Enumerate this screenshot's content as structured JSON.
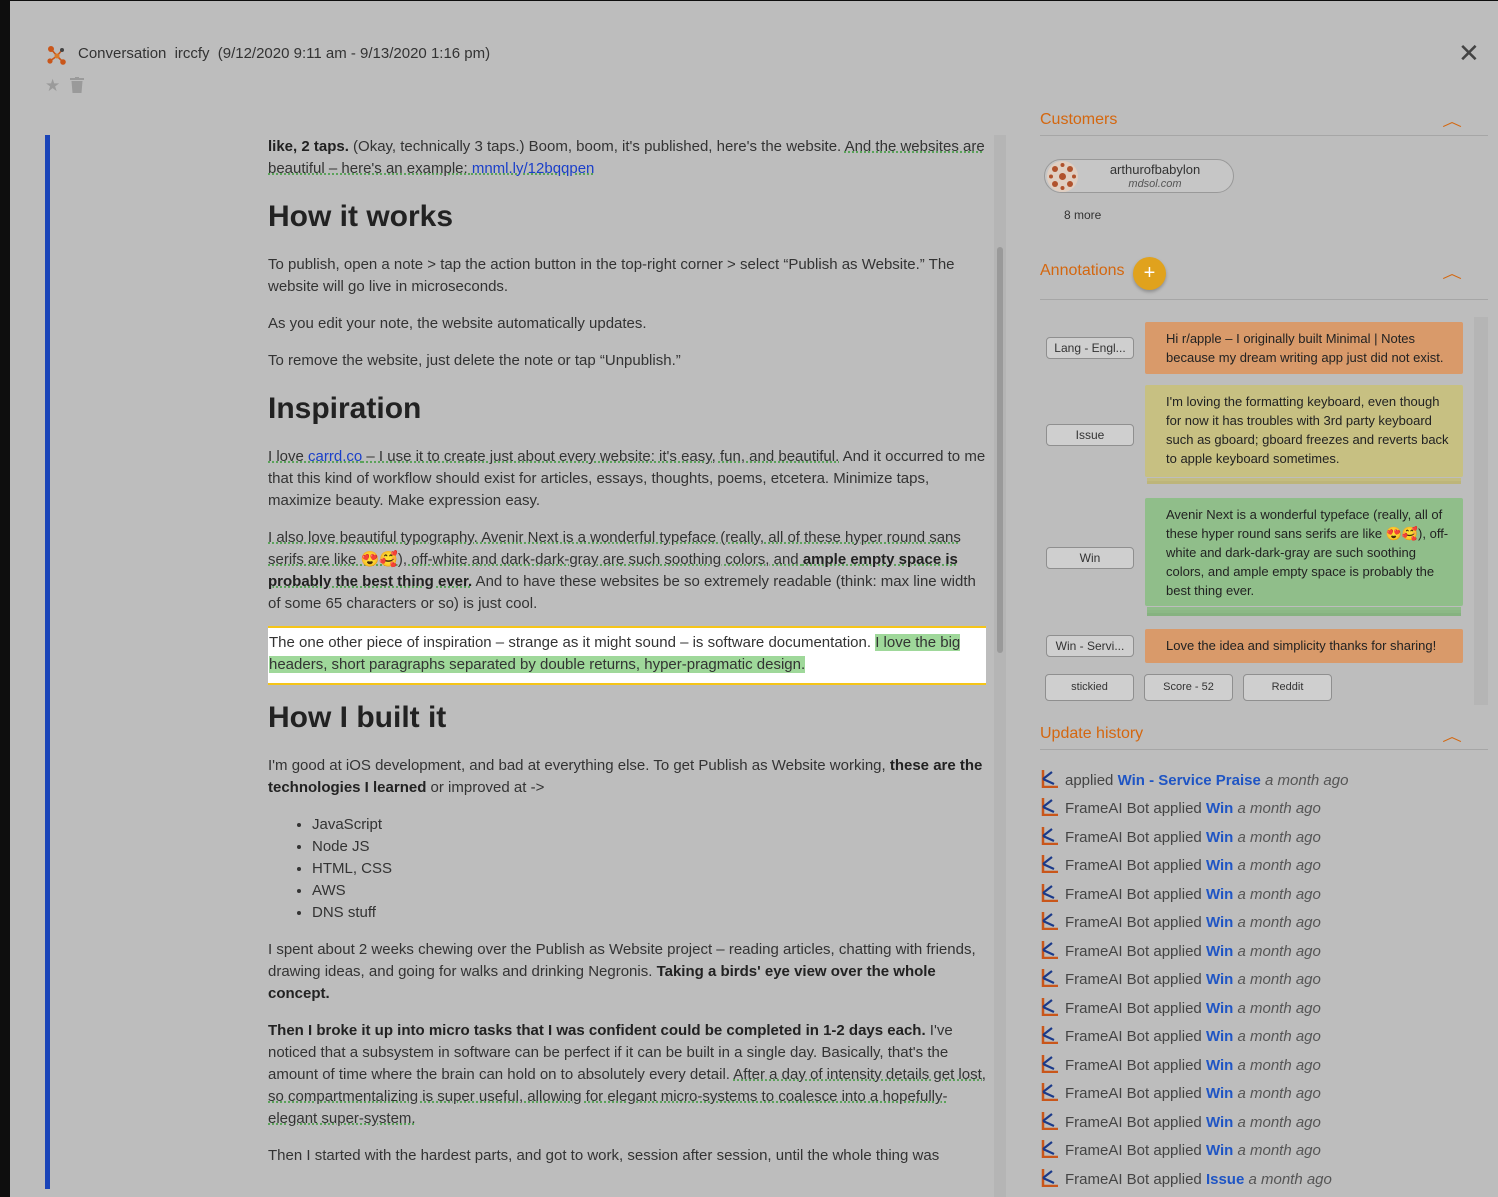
{
  "header": {
    "label": "Conversation",
    "id": "irccfy",
    "range": "(9/12/2020 9:11 am - 9/13/2020 1:16 pm)"
  },
  "doc": {
    "p1_bold": "like, 2 taps.",
    "p1_text": " (Okay, technically 3 taps.) Boom, boom, it's published, here's the website. ",
    "p1_ul": "And the websites are beautiful – here's an example: ",
    "p1_link": "mnml.ly/12bqqpen",
    "h_how": "How it works",
    "how_p1": "To publish, open a note > tap the action button in the top-right corner > select “Publish as Website.” The website will go live in microseconds.",
    "how_p2": "As you edit your note, the website automatically updates.",
    "how_p3": "To remove the website, just delete the note or tap “Unpublish.”",
    "h_insp": "Inspiration",
    "insp1_a": "I love ",
    "insp1_link": "carrd.co",
    "insp1_b": " – I use it to create just about every website: it's easy, fun, and beautiful.",
    "insp1_rest": " And it occurred to me that this kind of workflow should exist for articles, essays, thoughts, poems, etcetera. Minimize taps, maximize beauty. Make expression easy.",
    "insp2_ul": "I also love beautiful typography. Avenir Next is a wonderful typeface (really, all of these hyper round sans serifs are like 😍🥰), off-white and dark-dark-gray are such soothing colors, and ",
    "insp2_bold": "ample empty space is probably the best thing ever.",
    "insp2_rest": " And to have these websites be so extremely readable (think: max line width of some 65 characters or so) is just cool.",
    "quote_a": "The one other piece of inspiration – strange as it might sound – is software documentation. ",
    "quote_hl": "I love the big headers, short paragraphs separated by double returns, hyper-pragmatic design.",
    "h_built": "How I built it",
    "built_a": "I'm good at iOS development, and bad at everything else. To get Publish as Website working, ",
    "built_bold": "these are the technologies I learned",
    "built_b": " or improved at ->",
    "tech": [
      "JavaScript",
      "Node JS",
      "HTML, CSS",
      "AWS",
      "DNS stuff"
    ],
    "spent_a": "I spent about 2 weeks chewing over the Publish as Website project – reading articles, chatting with friends, drawing ideas, and going for walks and drinking Negronis. ",
    "spent_bold": "Taking a birds' eye view over the whole concept.",
    "broke_bold": "Then I broke it up into micro tasks that I was confident could be completed in 1-2 days each.",
    "broke_a": " I've noticed that a subsystem in software can be perfect if it can be built in a single day. Basically, that's the amount of time where the brain can hold on to absolutely every detail. ",
    "broke_ul": "After a day of intensity details get lost, so compartmentalizing is super useful, allowing for elegant micro-systems to coalesce into a hopefully-elegant super-system.",
    "last": "Then I started with the hardest parts, and got to work, session after session, until the whole thing was"
  },
  "customers": {
    "title": "Customers",
    "name": "arthurofbabylon",
    "domain": "mdsol.com",
    "more": "8 more"
  },
  "annotations": {
    "title": "Annotations",
    "add": "+",
    "items": [
      {
        "tag": "Lang - Engl...",
        "text": "Hi r/apple – I originally built Minimal | Notes because my dream writing app just did not exist."
      },
      {
        "tag": "Issue",
        "text": "I'm loving the formatting keyboard, even though for now it has troubles with 3rd party keyboard such as gboard; gboard freezes and reverts back to apple keyboard sometimes."
      },
      {
        "tag": "Win",
        "text": "Avenir Next is a wonderful typeface (really, all of these hyper round sans serifs are like 😍🥰), off-white and dark-dark-gray are such soothing colors, and ample empty space is probably the best thing ever."
      },
      {
        "tag": "Win - Servi...",
        "text": "Love the idea and simplicity thanks for sharing!"
      }
    ],
    "chips": [
      "stickied",
      "Score - 52",
      "Reddit"
    ]
  },
  "history": {
    "title": "Update history",
    "first": {
      "verb": "applied",
      "tag": "Win - Service Praise",
      "when": "a month ago"
    },
    "items": [
      {
        "actor": "FrameAI Bot",
        "verb": "applied",
        "tag": "Win",
        "when": "a month ago"
      },
      {
        "actor": "FrameAI Bot",
        "verb": "applied",
        "tag": "Win",
        "when": "a month ago"
      },
      {
        "actor": "FrameAI Bot",
        "verb": "applied",
        "tag": "Win",
        "when": "a month ago"
      },
      {
        "actor": "FrameAI Bot",
        "verb": "applied",
        "tag": "Win",
        "when": "a month ago"
      },
      {
        "actor": "FrameAI Bot",
        "verb": "applied",
        "tag": "Win",
        "when": "a month ago"
      },
      {
        "actor": "FrameAI Bot",
        "verb": "applied",
        "tag": "Win",
        "when": "a month ago"
      },
      {
        "actor": "FrameAI Bot",
        "verb": "applied",
        "tag": "Win",
        "when": "a month ago"
      },
      {
        "actor": "FrameAI Bot",
        "verb": "applied",
        "tag": "Win",
        "when": "a month ago"
      },
      {
        "actor": "FrameAI Bot",
        "verb": "applied",
        "tag": "Win",
        "when": "a month ago"
      },
      {
        "actor": "FrameAI Bot",
        "verb": "applied",
        "tag": "Win",
        "when": "a month ago"
      },
      {
        "actor": "FrameAI Bot",
        "verb": "applied",
        "tag": "Win",
        "when": "a month ago"
      },
      {
        "actor": "FrameAI Bot",
        "verb": "applied",
        "tag": "Win",
        "when": "a month ago"
      },
      {
        "actor": "FrameAI Bot",
        "verb": "applied",
        "tag": "Win",
        "when": "a month ago"
      },
      {
        "actor": "FrameAI Bot",
        "verb": "applied",
        "tag": "Issue",
        "when": "a month ago"
      }
    ]
  },
  "colors": {
    "accent_orange": "#d4670f",
    "accent_blue": "#1a44b8",
    "highlight_green": "#9fd89a",
    "focus_yellow": "#f5c518"
  },
  "icons": [
    "network-logo-icon",
    "star-icon",
    "trash-icon",
    "close-icon",
    "chevron-up-icon",
    "plus-icon",
    "frameai-bot-icon"
  ]
}
